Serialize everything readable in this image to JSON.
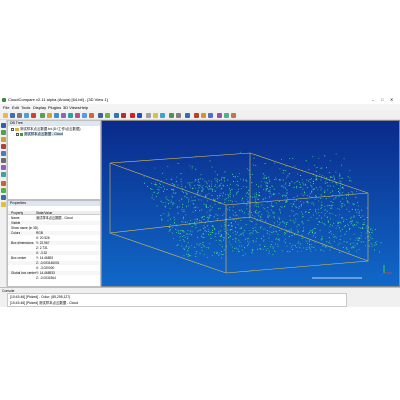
{
  "window": {
    "title": "CloudCompare v2.11 alpha (Anoia) [64-bit] - [3D View 1]"
  },
  "menu": [
    "File",
    "Edit",
    "Tools",
    "Display",
    "Plugins",
    "3D Views",
    "Help"
  ],
  "db_tree": {
    "title": "DB Tree",
    "items": [
      {
        "label": "测试样本点云数据.txt (D:/工作/点云数据)"
      },
      {
        "label": "测试样本点云数据 - Cloud"
      }
    ]
  },
  "properties": {
    "title": "Properties",
    "header": {
      "property": "Property",
      "value": "State/Value"
    },
    "rows": [
      {
        "key": "Name",
        "value": "测试样本点云数据 - Cloud"
      },
      {
        "key": "Visible",
        "value": ""
      },
      {
        "key": "Show name (in 3D)",
        "value": ""
      },
      {
        "key": "Colors",
        "value": "RGB"
      },
      {
        "key": "",
        "value": "X: 20.526"
      },
      {
        "key": "Box dimensions",
        "value": "Y: 22.967"
      },
      {
        "key": "",
        "value": "Z: 2.731"
      },
      {
        "key": "",
        "value": "X: -3.32"
      },
      {
        "key": "Box center",
        "value": "Y: 14.46893"
      },
      {
        "key": "",
        "value": "Z: -0.003146001"
      },
      {
        "key": "",
        "value": "X: -3.020000"
      },
      {
        "key": "Global box center",
        "value": "Y: 14.468933"
      },
      {
        "key": "",
        "value": "Z: -0.0031564"
      }
    ]
  },
  "console": {
    "title": "Console",
    "lines": [
      "[10:43:46] [Picked]          - Color: (85,255,127)",
      "[10:43:46] [Picked] 测试样本点云数据 - Cloud"
    ]
  },
  "colors": {
    "view_top": "#0a2a8a",
    "view_bottom": "#1068c8",
    "points": "#55ff7f",
    "box": "#e0c050"
  }
}
